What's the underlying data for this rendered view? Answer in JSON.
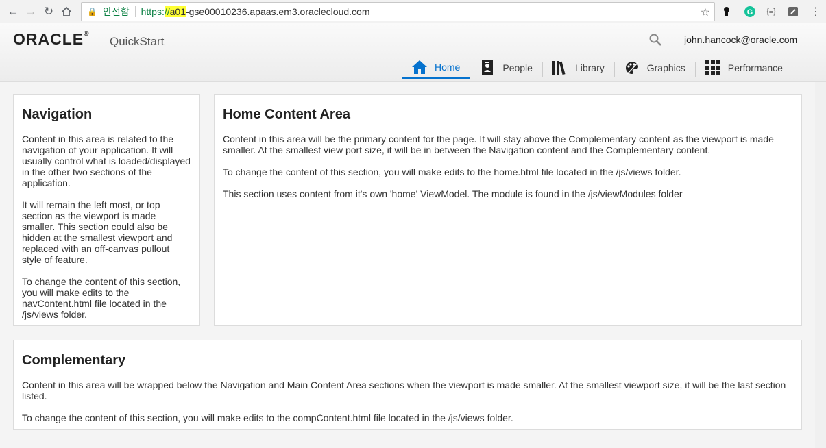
{
  "browser": {
    "secure_label": "안전함",
    "url_scheme": "https:",
    "url_slashes": "//",
    "url_highlight": "a01",
    "url_rest": "-gse00010236.apaas.em3.oraclecloud.com"
  },
  "header": {
    "logo": "ORACLE",
    "app_name": "QuickStart",
    "user": "john.hancock@oracle.com"
  },
  "tabs": [
    {
      "label": "Home",
      "icon": "home-icon"
    },
    {
      "label": "People",
      "icon": "person-icon"
    },
    {
      "label": "Library",
      "icon": "books-icon"
    },
    {
      "label": "Graphics",
      "icon": "palette-icon"
    },
    {
      "label": "Performance",
      "icon": "grid-icon"
    }
  ],
  "navigation": {
    "title": "Navigation",
    "p1": "Content in this area is related to the navigation of your application. It will usually control what is loaded/displayed in the other two sections of the application.",
    "p2": "It will remain the left most, or top section as the viewport is made smaller. This section could also be hidden at the smallest viewport and replaced with an off-canvas pullout style of feature.",
    "p3": "To change the content of this section, you will make edits to the navContent.html file located in the /js/views folder."
  },
  "main": {
    "title": "Home Content Area",
    "p1": "Content in this area will be the primary content for the page. It will stay above the Complementary content as the viewport is made smaller. At the smallest view port size, it will be in between the Navigation content and the Complementary content.",
    "p2": "To change the content of this section, you will make edits to the home.html file located in the /js/views folder.",
    "p3": "This section uses content from it's own 'home' ViewModel. The module is found in the /js/viewModules folder"
  },
  "complementary": {
    "title": "Complementary",
    "p1": "Content in this area will be wrapped below the Navigation and Main Content Area sections when the viewport is made smaller. At the smallest viewport size, it will be the last section listed.",
    "p2": "To change the content of this section, you will make edits to the compContent.html file located in the /js/views folder."
  },
  "colors": {
    "accent": "#0572ce",
    "secure": "#0b8043",
    "highlight": "#ffff33"
  }
}
